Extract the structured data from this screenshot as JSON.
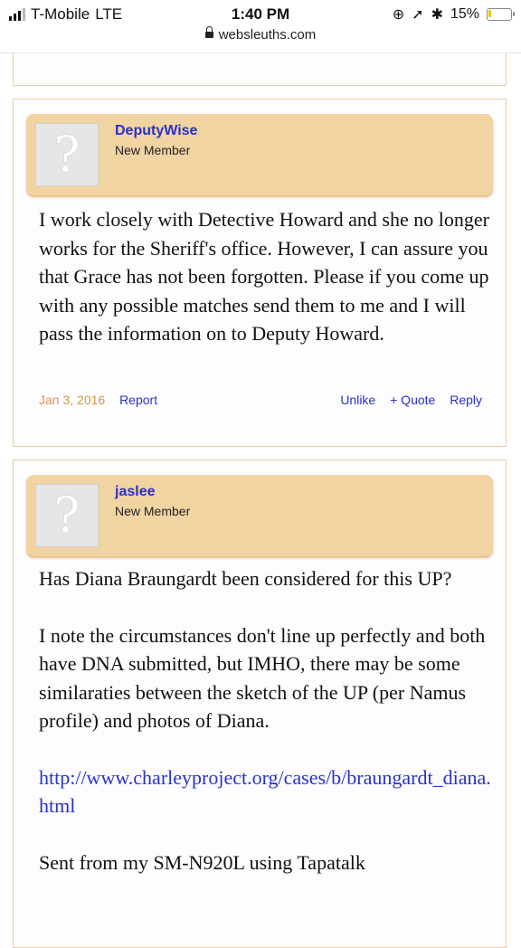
{
  "status": {
    "carrier": "T-Mobile",
    "network": "LTE",
    "time": "1:40 PM",
    "url": "websleuths.com",
    "battery": "15%",
    "battery_level": 0.15
  },
  "posts": [
    {
      "username": "DeputyWise",
      "role": "New Member",
      "body": "I work closely with Detective Howard and she no longer works for the Sheriff's office. However, I can assure you that Grace has not been forgotten. Please if you come up with any possible matches send them to me and I will pass the information on to Deputy Howard.",
      "date": "Jan 3, 2016",
      "report": "Report",
      "unlike": "Unlike",
      "quote": "+ Quote",
      "reply": "Reply"
    },
    {
      "username": "jaslee",
      "role": "New Member",
      "body_p1": "Has Diana Braungardt been considered for this UP?",
      "body_p2": "I note the circumstances don't line up perfectly and both have DNA submitted, but IMHO, there may be some similaraties between the sketch of the UP (per Namus profile) and photos of Diana.",
      "link": "http://www.charleyproject.org/cases/b/braungardt_diana.html",
      "body_p3": "Sent from my SM-N920L using Tapatalk"
    }
  ]
}
